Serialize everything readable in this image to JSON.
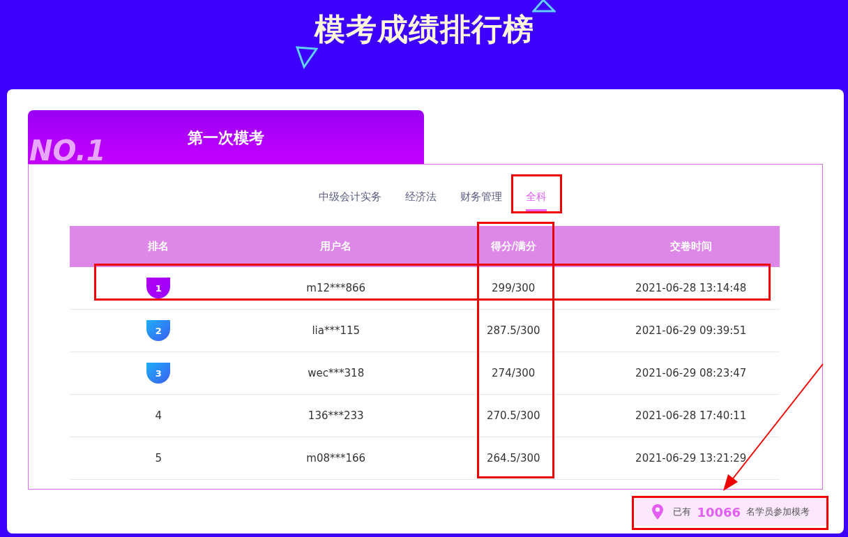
{
  "page_title": "模考成绩排行榜",
  "exam_tab": {
    "title": "第一次模考",
    "badge": "NO.1"
  },
  "subject_tabs": [
    {
      "label": "中级会计实务",
      "selected": false
    },
    {
      "label": "经济法",
      "selected": false
    },
    {
      "label": "财务管理",
      "selected": false
    },
    {
      "label": "全科",
      "selected": true
    }
  ],
  "table": {
    "columns": [
      "排名",
      "用户名",
      "得分/满分",
      "交卷时间"
    ],
    "rows": [
      {
        "rank": "1",
        "kind": "first",
        "user": "m12***866",
        "score": "299/300",
        "time": "2021-06-28 13:14:48"
      },
      {
        "rank": "2",
        "kind": "podium",
        "user": "lia***115",
        "score": "287.5/300",
        "time": "2021-06-29 09:39:51"
      },
      {
        "rank": "3",
        "kind": "podium",
        "user": "wec***318",
        "score": "274/300",
        "time": "2021-06-29 08:23:47"
      },
      {
        "rank": "4",
        "kind": "plain",
        "user": "136***233",
        "score": "270.5/300",
        "time": "2021-06-28 17:40:11"
      },
      {
        "rank": "5",
        "kind": "plain",
        "user": "m08***166",
        "score": "264.5/300",
        "time": "2021-06-29 13:21:29"
      }
    ]
  },
  "participants": {
    "prefix": "已有",
    "count": "10066",
    "suffix": "名学员参加模考"
  }
}
